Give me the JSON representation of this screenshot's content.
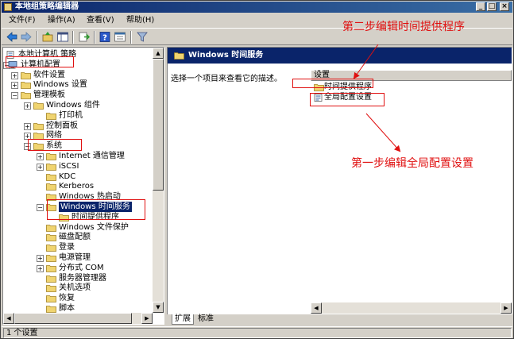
{
  "window": {
    "title": "本地组策略编辑器",
    "controls": {
      "minimize": "_",
      "maximize": "□",
      "close": "×"
    }
  },
  "menu": [
    "文件(F)",
    "操作(A)",
    "查看(V)",
    "帮助(H)"
  ],
  "toolbar": [
    "back-icon",
    "forward-icon",
    "up-icon",
    "show-hide-tree-icon",
    "export-icon",
    "help-icon",
    "properties-icon",
    "filter-icon"
  ],
  "tree": {
    "items": [
      {
        "label": "本地计算机 策略",
        "icon": "policy-icon"
      },
      {
        "label": "计算机配置",
        "icon": "computer-icon",
        "expander": "−"
      },
      {
        "label": "软件设置",
        "icon": "folder-icon",
        "expander": "+"
      },
      {
        "label": "Windows 设置",
        "icon": "folder-icon",
        "expander": "+"
      },
      {
        "label": "管理模板",
        "icon": "folder-icon",
        "expander": "−"
      },
      {
        "label": "Windows 组件",
        "icon": "folder-icon",
        "expander": "+"
      },
      {
        "label": "打印机",
        "icon": "folder-icon"
      },
      {
        "label": "控制面板",
        "icon": "folder-icon",
        "expander": "+"
      },
      {
        "label": "网络",
        "icon": "folder-icon",
        "expander": "+"
      },
      {
        "label": "系统",
        "icon": "folder-icon",
        "expander": "−"
      },
      {
        "label": "Internet 通信管理",
        "icon": "folder-icon",
        "expander": "+"
      },
      {
        "label": "iSCSI",
        "icon": "folder-icon",
        "expander": "+"
      },
      {
        "label": "KDC",
        "icon": "folder-icon"
      },
      {
        "label": "Kerberos",
        "icon": "folder-icon"
      },
      {
        "label": "Windows 热启动",
        "icon": "folder-icon"
      },
      {
        "label": "Windows 时间服务",
        "icon": "folder-icon",
        "expander": "−",
        "selected": true
      },
      {
        "label": "时间提供程序",
        "icon": "folder-icon"
      },
      {
        "label": "Windows 文件保护",
        "icon": "folder-icon"
      },
      {
        "label": "磁盘配额",
        "icon": "folder-icon"
      },
      {
        "label": "登录",
        "icon": "folder-icon"
      },
      {
        "label": "电源管理",
        "icon": "folder-icon",
        "expander": "+"
      },
      {
        "label": "分布式 COM",
        "icon": "folder-icon",
        "expander": "+"
      },
      {
        "label": "服务器管理器",
        "icon": "folder-icon"
      },
      {
        "label": "关机选项",
        "icon": "folder-icon"
      },
      {
        "label": "恢复",
        "icon": "folder-icon"
      },
      {
        "label": "脚本",
        "icon": "folder-icon"
      }
    ]
  },
  "right": {
    "header": "Windows 时间服务",
    "description": "选择一个项目来查看它的描述。",
    "column": "设置",
    "items": [
      {
        "label": "时间提供程序",
        "icon": "folder-icon"
      },
      {
        "label": "全局配置设置",
        "icon": "setting-icon"
      }
    ]
  },
  "tabs": [
    "扩展",
    "标准"
  ],
  "status": "1 个设置",
  "annotations": {
    "step2": "第二步编辑时间提供程序",
    "step1": "第一步编辑全局配置设置"
  },
  "colors": {
    "annotation": "#e01010",
    "header": "#0a246a"
  }
}
